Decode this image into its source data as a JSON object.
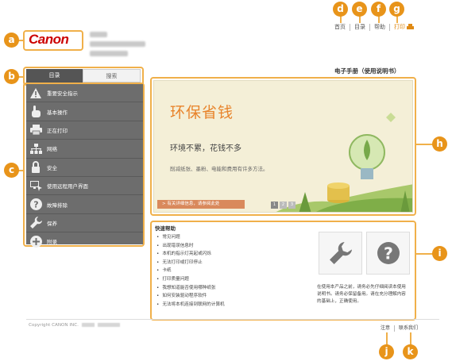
{
  "header": {
    "logo": "Canon",
    "links": [
      "首页",
      "目录",
      "帮助",
      "打印"
    ]
  },
  "sidebar": {
    "tabs": [
      "目录",
      "搜索"
    ],
    "items": [
      "重要安全指示",
      "基本操作",
      "正在打印",
      "网络",
      "安全",
      "使用远程用户界面",
      "故障排除",
      "保养",
      "附录"
    ]
  },
  "main": {
    "manual_title": "电子手册（使用说明书）",
    "banner": {
      "headline": "环保省钱",
      "subhead": "环境不累，花钱不多",
      "text": "削减纸张、墨粉、电能和费用有许多方法。",
      "link": "> 有关详细信息，请参阅此处",
      "pages": [
        "1",
        "2",
        "3"
      ]
    },
    "quick": {
      "title": "快速帮助",
      "items": [
        "常见问题",
        "出现错误信息时",
        "本机的指示灯亮起或闪烁",
        "无法打印或打印停止",
        "卡纸",
        "打印质量问题",
        "我想知道能否使用哪种纸张",
        "如何安装驱动程序软件",
        "无法将本机连接到联网的计算机"
      ],
      "description": "在使用本产品之前，请务必先仔细阅读本使用说明书。请务必保留备用。请在充分理解内容的基础上，正确使用。"
    }
  },
  "footer": {
    "copyright": "Copyright CANON INC.",
    "links": [
      "注意",
      "联系我们"
    ]
  },
  "callouts": [
    "a",
    "b",
    "c",
    "d",
    "e",
    "f",
    "g",
    "h",
    "i",
    "j",
    "k"
  ]
}
